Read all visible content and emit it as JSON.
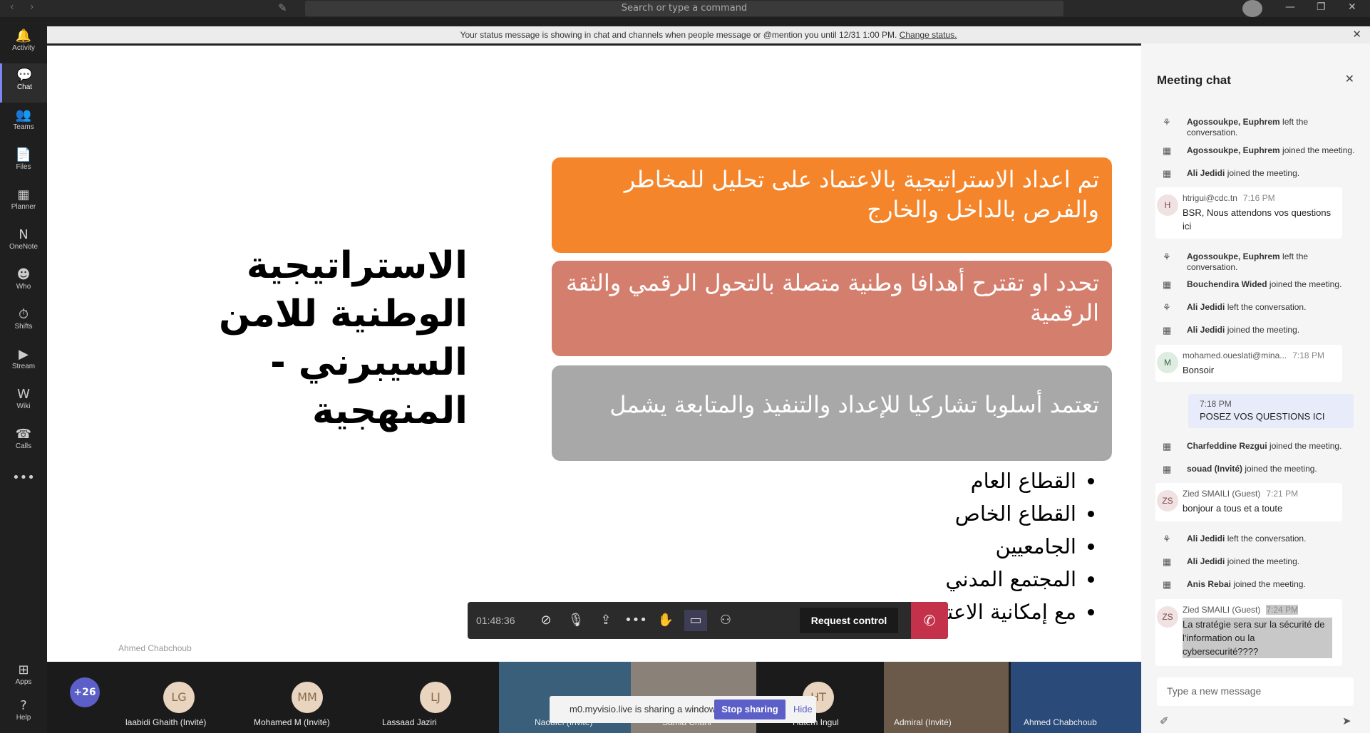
{
  "titlebar": {
    "search_placeholder": "Search or type a command"
  },
  "rail": [
    {
      "label": "Activity",
      "icon": "bell-icon",
      "glyph": "🔔"
    },
    {
      "label": "Chat",
      "icon": "chat-icon",
      "glyph": "💬"
    },
    {
      "label": "Teams",
      "icon": "teams-icon",
      "glyph": "👥"
    },
    {
      "label": "Files",
      "icon": "files-icon",
      "glyph": "📄"
    },
    {
      "label": "Planner",
      "icon": "planner-icon",
      "glyph": "▦"
    },
    {
      "label": "OneNote",
      "icon": "onenote-icon",
      "glyph": "N"
    },
    {
      "label": "Who",
      "icon": "who-icon",
      "glyph": "☻"
    },
    {
      "label": "Shifts",
      "icon": "shifts-icon",
      "glyph": "⏱"
    },
    {
      "label": "Stream",
      "icon": "stream-icon",
      "glyph": "▶"
    },
    {
      "label": "Wiki",
      "icon": "wiki-icon",
      "glyph": "W"
    },
    {
      "label": "Calls",
      "icon": "calls-icon",
      "glyph": "☎"
    },
    {
      "label": "Apps",
      "icon": "apps-icon",
      "glyph": "⊞"
    },
    {
      "label": "Help",
      "icon": "help-icon",
      "glyph": "?"
    }
  ],
  "banner": {
    "text": "Your status message is showing in chat and channels when people message or @mention you until 12/31 1:00 PM.",
    "link": "Change status."
  },
  "slide": {
    "title": "الاستراتيجية الوطنية للامن السيبرني - المنهجية",
    "box1": "تم اعداد الاستراتيجية بالاعتماد على تحليل للمخاطر والفرص بالداخل والخارج",
    "box2": "تحدد او تقترح أهدافا وطنية متصلة بالتحول الرقمي والثقة الرقمية",
    "box3": "تعتمد أسلوبا تشاركيا للإعداد والتنفيذ والمتابعة يشمل",
    "bullets": [
      "القطاع العام",
      "القطاع الخاص",
      "الجامعيين",
      "المجتمع المدني",
      "مع إمكانية الاعتماد على خبراء مختصين في هذا المجال."
    ],
    "watermark": "Ahmed Chabchoub"
  },
  "controls": {
    "timer": "01:48:36",
    "request_control": "Request control"
  },
  "participants": {
    "more": "+26",
    "tiles": [
      {
        "initials": "LG",
        "name": "laabidi Ghaith (Invité)"
      },
      {
        "initials": "MM",
        "name": "Mohamed M (Invité)"
      },
      {
        "initials": "LJ",
        "name": "Lassaad Jaziri"
      }
    ],
    "video_names": [
      "Naoufel (Invité)",
      "Samia Chahi",
      "Hatem Ingul",
      "Admiral (Invité)",
      "Ahmed Chabchoub"
    ]
  },
  "share": {
    "text": "m0.myvisio.live is sharing a window.",
    "stop": "Stop sharing",
    "hide": "Hide"
  },
  "chat": {
    "title": "Meeting chat",
    "events": [
      {
        "who": "Agossoukpe, Euphrem",
        "what": "left the conversation."
      },
      {
        "who": "Agossoukpe, Euphrem",
        "what": "joined the meeting."
      },
      {
        "who": "Ali Jedidi",
        "what": "joined the meeting."
      },
      {
        "who": "Agossoukpe, Euphrem",
        "what": "left the conversation."
      },
      {
        "who": "Bouchendira Wided",
        "what": "joined the meeting."
      },
      {
        "who": "Ali Jedidi",
        "what": "left the conversation."
      },
      {
        "who": "Ali Jedidi",
        "what": "joined the meeting."
      },
      {
        "who": "Charfeddine Rezgui",
        "what": "joined the meeting."
      },
      {
        "who": "souad (Invité)",
        "what": "joined the meeting."
      },
      {
        "who": "Ali Jedidi",
        "what": "left the conversation."
      },
      {
        "who": "Ali Jedidi",
        "what": "joined the meeting."
      },
      {
        "who": "Anis Rebai",
        "what": "joined the meeting."
      }
    ],
    "messages": [
      {
        "initials": "H",
        "sender": "htrigui@cdc.tn",
        "time": "7:16 PM",
        "text": "BSR, Nous attendons vos questions ici"
      },
      {
        "initials": "M",
        "sender": "mohamed.oueslati@mina...",
        "time": "7:18 PM",
        "text": "Bonsoir"
      },
      {
        "initials": "ZS",
        "sender": "Zied SMAILI (Guest)",
        "time": "7:21 PM",
        "text": "bonjour a tous et a toute"
      },
      {
        "initials": "ZS",
        "sender": "Zied SMAILI (Guest)",
        "time": "7:24 PM",
        "text": "La stratégie sera sur la sécurité de l'information ou la cybersecurité????"
      }
    ],
    "mine": {
      "time": "7:18 PM",
      "text": "POSEZ VOS QUESTIONS ICI"
    },
    "compose_placeholder": "Type a new message"
  }
}
